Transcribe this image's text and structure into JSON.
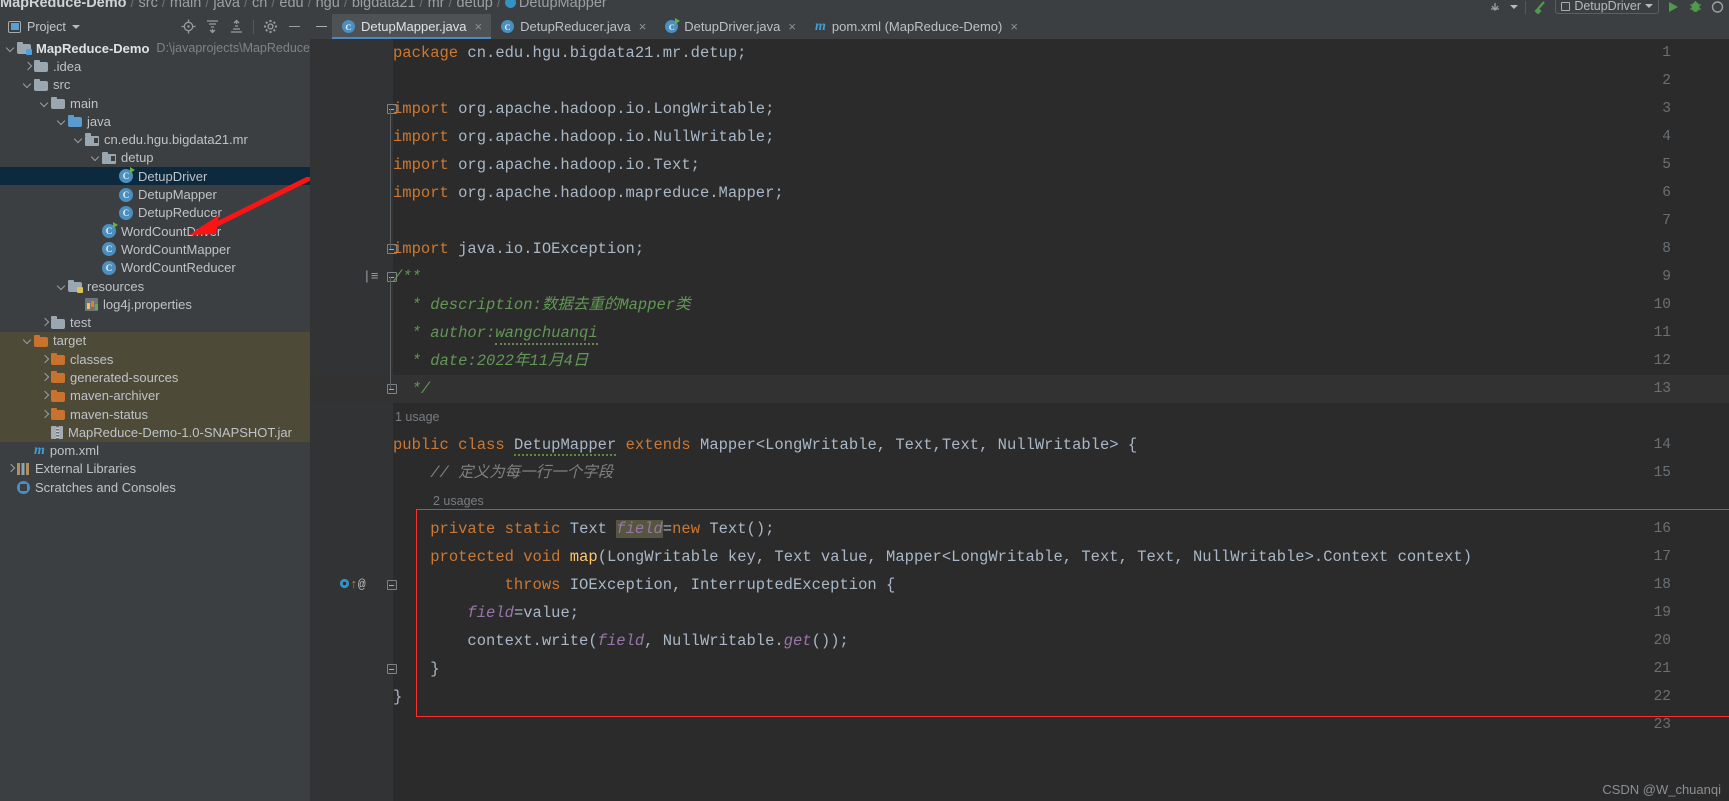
{
  "window": {
    "breadcrumb": [
      "MapReduce-Demo",
      "src",
      "main",
      "java",
      "cn",
      "edu",
      "hgu",
      "bigdata21",
      "mr",
      "detup",
      "DetupMapper"
    ],
    "run_configuration": "DetupDriver"
  },
  "project_toolbar": {
    "title": "Project",
    "icons": [
      "locate-icon",
      "expand-all-icon",
      "collapse-all-icon",
      "settings-gear-icon",
      "hide-icon"
    ]
  },
  "tree": [
    {
      "depth": 0,
      "arrow": "open",
      "icon": "project-folder-icon",
      "label": "MapReduce-Demo",
      "bold": true,
      "path": "D:\\javaprojects\\MapReduce-De",
      "state": ""
    },
    {
      "depth": 1,
      "arrow": "closed",
      "icon": "folder-gray-icon",
      "label": ".idea",
      "bold": false,
      "path": "",
      "state": ""
    },
    {
      "depth": 1,
      "arrow": "open",
      "icon": "folder-gray-icon",
      "label": "src",
      "bold": false,
      "path": "",
      "state": ""
    },
    {
      "depth": 2,
      "arrow": "open",
      "icon": "folder-gray-icon",
      "label": "main",
      "bold": false,
      "path": "",
      "state": ""
    },
    {
      "depth": 3,
      "arrow": "open",
      "icon": "folder-blue-icon",
      "label": "java",
      "bold": false,
      "path": "",
      "state": ""
    },
    {
      "depth": 4,
      "arrow": "open",
      "icon": "package-icon",
      "label": "cn.edu.hgu.bigdata21.mr",
      "bold": false,
      "path": "",
      "state": ""
    },
    {
      "depth": 5,
      "arrow": "open",
      "icon": "package-icon",
      "label": "detup",
      "bold": false,
      "path": "",
      "state": ""
    },
    {
      "depth": 6,
      "arrow": "none",
      "icon": "java-class-run-icon",
      "label": "DetupDriver",
      "bold": false,
      "path": "",
      "state": "selected"
    },
    {
      "depth": 6,
      "arrow": "none",
      "icon": "java-class-icon",
      "label": "DetupMapper",
      "bold": false,
      "path": "",
      "state": ""
    },
    {
      "depth": 6,
      "arrow": "none",
      "icon": "java-class-icon",
      "label": "DetupReducer",
      "bold": false,
      "path": "",
      "state": ""
    },
    {
      "depth": 5,
      "arrow": "none",
      "icon": "java-class-run-icon",
      "label": "WordCountDriver",
      "bold": false,
      "path": "",
      "state": ""
    },
    {
      "depth": 5,
      "arrow": "none",
      "icon": "java-class-icon",
      "label": "WordCountMapper",
      "bold": false,
      "path": "",
      "state": ""
    },
    {
      "depth": 5,
      "arrow": "none",
      "icon": "java-class-icon",
      "label": "WordCountReducer",
      "bold": false,
      "path": "",
      "state": ""
    },
    {
      "depth": 3,
      "arrow": "open",
      "icon": "folder-resources-icon",
      "label": "resources",
      "bold": false,
      "path": "",
      "state": ""
    },
    {
      "depth": 4,
      "arrow": "none",
      "icon": "properties-file-icon",
      "label": "log4j.properties",
      "bold": false,
      "path": "",
      "state": ""
    },
    {
      "depth": 2,
      "arrow": "closed",
      "icon": "folder-gray-icon",
      "label": "test",
      "bold": false,
      "path": "",
      "state": ""
    },
    {
      "depth": 1,
      "arrow": "open",
      "icon": "folder-orange-icon",
      "label": "target",
      "bold": false,
      "path": "",
      "state": "target"
    },
    {
      "depth": 2,
      "arrow": "closed",
      "icon": "folder-orange-icon",
      "label": "classes",
      "bold": false,
      "path": "",
      "state": "target"
    },
    {
      "depth": 2,
      "arrow": "closed",
      "icon": "folder-orange-icon",
      "label": "generated-sources",
      "bold": false,
      "path": "",
      "state": "target"
    },
    {
      "depth": 2,
      "arrow": "closed",
      "icon": "folder-orange-icon",
      "label": "maven-archiver",
      "bold": false,
      "path": "",
      "state": "target"
    },
    {
      "depth": 2,
      "arrow": "closed",
      "icon": "folder-orange-icon",
      "label": "maven-status",
      "bold": false,
      "path": "",
      "state": "target"
    },
    {
      "depth": 2,
      "arrow": "none",
      "icon": "jar-file-icon",
      "label": "MapReduce-Demo-1.0-SNAPSHOT.jar",
      "bold": false,
      "path": "",
      "state": "target"
    },
    {
      "depth": 1,
      "arrow": "none",
      "icon": "maven-pom-icon",
      "label": "pom.xml",
      "bold": false,
      "path": "",
      "state": ""
    },
    {
      "depth": 0,
      "arrow": "closed",
      "icon": "external-libraries-icon",
      "label": "External Libraries",
      "bold": false,
      "path": "",
      "state": ""
    },
    {
      "depth": 0,
      "arrow": "none",
      "icon": "scratches-icon",
      "label": "Scratches and Consoles",
      "bold": false,
      "path": "",
      "state": ""
    }
  ],
  "tabs": [
    {
      "label": "DetupMapper.java",
      "icon": "java-class-icon",
      "active": true,
      "close": "×"
    },
    {
      "label": "DetupReducer.java",
      "icon": "java-class-icon",
      "active": false,
      "close": "×"
    },
    {
      "label": "DetupDriver.java",
      "icon": "java-class-run-icon",
      "active": false,
      "close": "×"
    },
    {
      "label": "pom.xml (MapReduce-Demo)",
      "icon": "maven-pom-icon",
      "active": false,
      "close": "×"
    }
  ],
  "editor": {
    "line_numbers": [
      "1",
      "2",
      "3",
      "4",
      "5",
      "6",
      "7",
      "8",
      "9",
      "10",
      "11",
      "12",
      "13",
      "14",
      "15",
      "16",
      "17",
      "18",
      "19",
      "20",
      "21",
      "22",
      "23"
    ],
    "inlay_hints": [
      {
        "line": 14,
        "text": "1 usage"
      },
      {
        "line": 16,
        "text": "2 usages"
      }
    ],
    "gutter_marks": [
      {
        "line": 17,
        "text": "Ⓘ↑@"
      }
    ],
    "code_lines": [
      "package cn.edu.hgu.bigdata21.mr.detup;",
      "",
      "import org.apache.hadoop.io.LongWritable;",
      "import org.apache.hadoop.io.NullWritable;",
      "import org.apache.hadoop.io.Text;",
      "import org.apache.hadoop.mapreduce.Mapper;",
      "",
      "import java.io.IOException;",
      "/**",
      " * description:数据去重的Mapper类",
      " * author:wangchuanqi",
      " * date:2022年11月4日",
      " */",
      "public class DetupMapper extends Mapper<LongWritable, Text,Text, NullWritable> {",
      "    // 定义为每一行一个字段",
      "    private static Text field=new Text();",
      "    protected void map(LongWritable key, Text value, Mapper<LongWritable, Text, Text, NullWritable>.Context context)",
      "            throws IOException, InterruptedException {",
      "        field=value;",
      "        context.write(field, NullWritable.get());",
      "    }",
      "}",
      ""
    ]
  },
  "watermark": "CSDN @W_chuanqi"
}
